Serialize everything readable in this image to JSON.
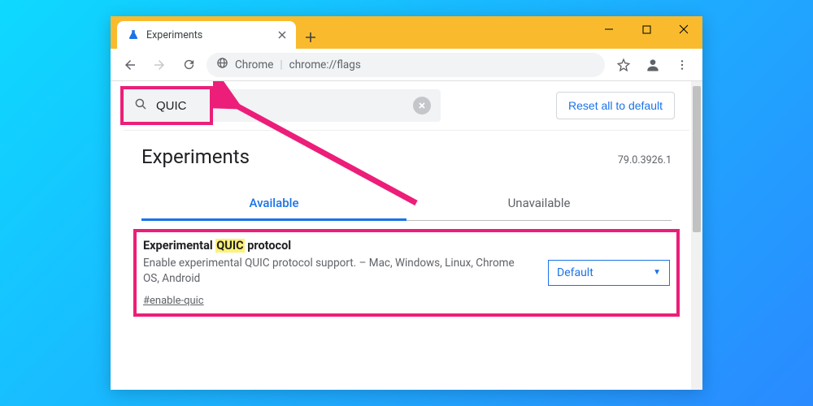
{
  "window": {
    "tab_title": "Experiments"
  },
  "omnibox": {
    "chip": "Chrome",
    "url": "chrome://flags"
  },
  "search": {
    "value": "QUIC"
  },
  "reset_button": "Reset all to default",
  "heading": "Experiments",
  "version": "79.0.3926.1",
  "tabs": {
    "available": "Available",
    "unavailable": "Unavailable"
  },
  "flag": {
    "title_prefix": "Experimental ",
    "title_highlight": "QUIC",
    "title_suffix": " protocol",
    "description": "Enable experimental QUIC protocol support. – Mac, Windows, Linux, Chrome OS, Android",
    "anchor": "#enable-quic",
    "select_value": "Default"
  }
}
